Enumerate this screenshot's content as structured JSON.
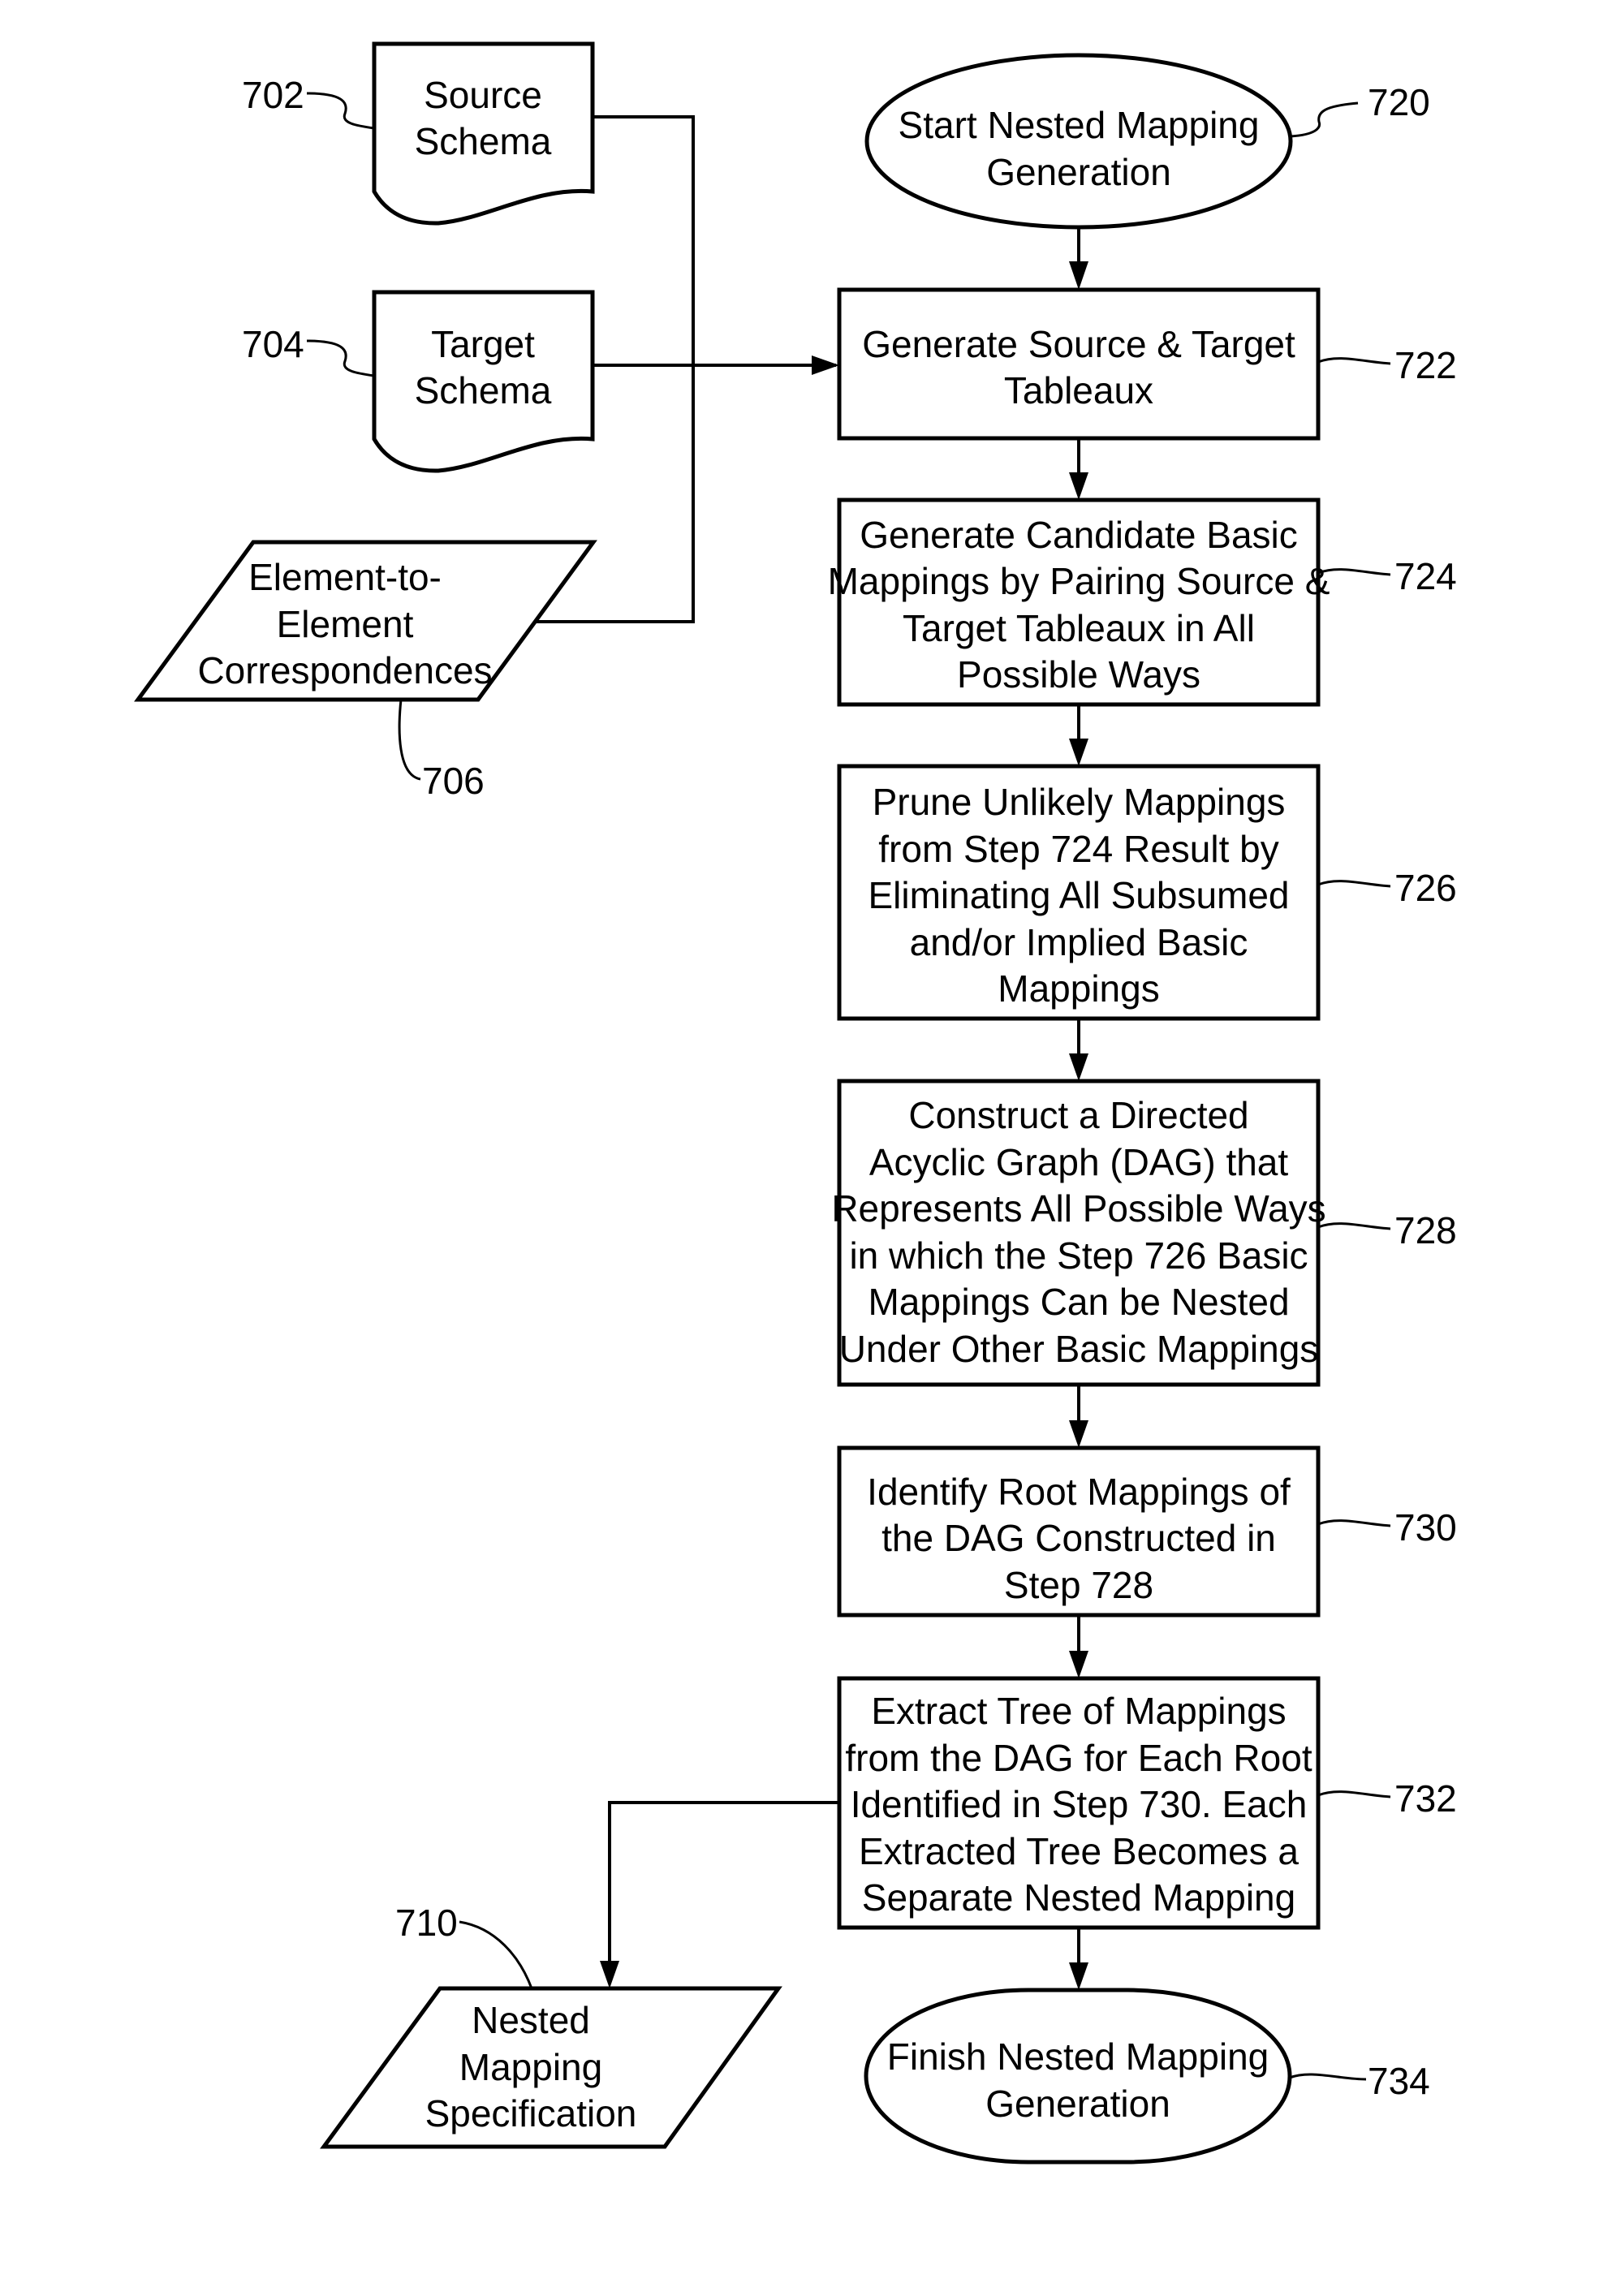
{
  "figure": {
    "nodes": {
      "source_schema": {
        "ref": "702",
        "lines": [
          "Source",
          "Schema"
        ]
      },
      "target_schema": {
        "ref": "704",
        "lines": [
          "Target",
          "Schema"
        ]
      },
      "correspondences": {
        "ref": "706",
        "lines": [
          "Element-to-",
          "Element",
          "Correspondences"
        ]
      },
      "start": {
        "ref": "720",
        "lines": [
          "Start Nested Mapping",
          "Generation"
        ]
      },
      "step_722": {
        "ref": "722",
        "lines": [
          "Generate Source & Target",
          "Tableaux"
        ]
      },
      "step_724": {
        "ref": "724",
        "lines": [
          "Generate Candidate Basic",
          "Mappings by Pairing Source &",
          "Target Tableaux in All",
          "Possible Ways"
        ]
      },
      "step_726": {
        "ref": "726",
        "lines": [
          "Prune Unlikely Mappings",
          "from Step 724 Result by",
          "Eliminating All Subsumed",
          "and/or Implied Basic",
          "Mappings"
        ]
      },
      "step_728": {
        "ref": "728",
        "lines": [
          "Construct a Directed",
          "Acyclic Graph (DAG) that",
          "Represents All Possible Ways",
          "in which the Step 726 Basic",
          "Mappings Can be Nested",
          "Under Other Basic Mappings"
        ]
      },
      "step_730": {
        "ref": "730",
        "lines": [
          "Identify Root Mappings of",
          "the DAG Constructed in",
          "Step 728"
        ]
      },
      "step_732": {
        "ref": "732",
        "lines": [
          "Extract Tree of Mappings",
          "from the DAG for Each Root",
          "Identified in Step 730. Each",
          "Extracted Tree Becomes a",
          "Separate Nested Mapping"
        ]
      },
      "nested_spec": {
        "ref": "710",
        "lines": [
          "Nested",
          "Mapping",
          "Specification"
        ]
      },
      "finish": {
        "ref": "734",
        "lines": [
          "Finish Nested Mapping",
          "Generation"
        ]
      }
    },
    "edges": [
      {
        "from": "source_schema",
        "to": "step_722"
      },
      {
        "from": "target_schema",
        "to": "step_722"
      },
      {
        "from": "correspondences",
        "to": "step_722"
      },
      {
        "from": "start",
        "to": "step_722"
      },
      {
        "from": "step_722",
        "to": "step_724"
      },
      {
        "from": "step_724",
        "to": "step_726"
      },
      {
        "from": "step_726",
        "to": "step_728"
      },
      {
        "from": "step_728",
        "to": "step_730"
      },
      {
        "from": "step_730",
        "to": "step_732"
      },
      {
        "from": "step_732",
        "to": "nested_spec"
      },
      {
        "from": "step_732",
        "to": "finish"
      }
    ]
  }
}
